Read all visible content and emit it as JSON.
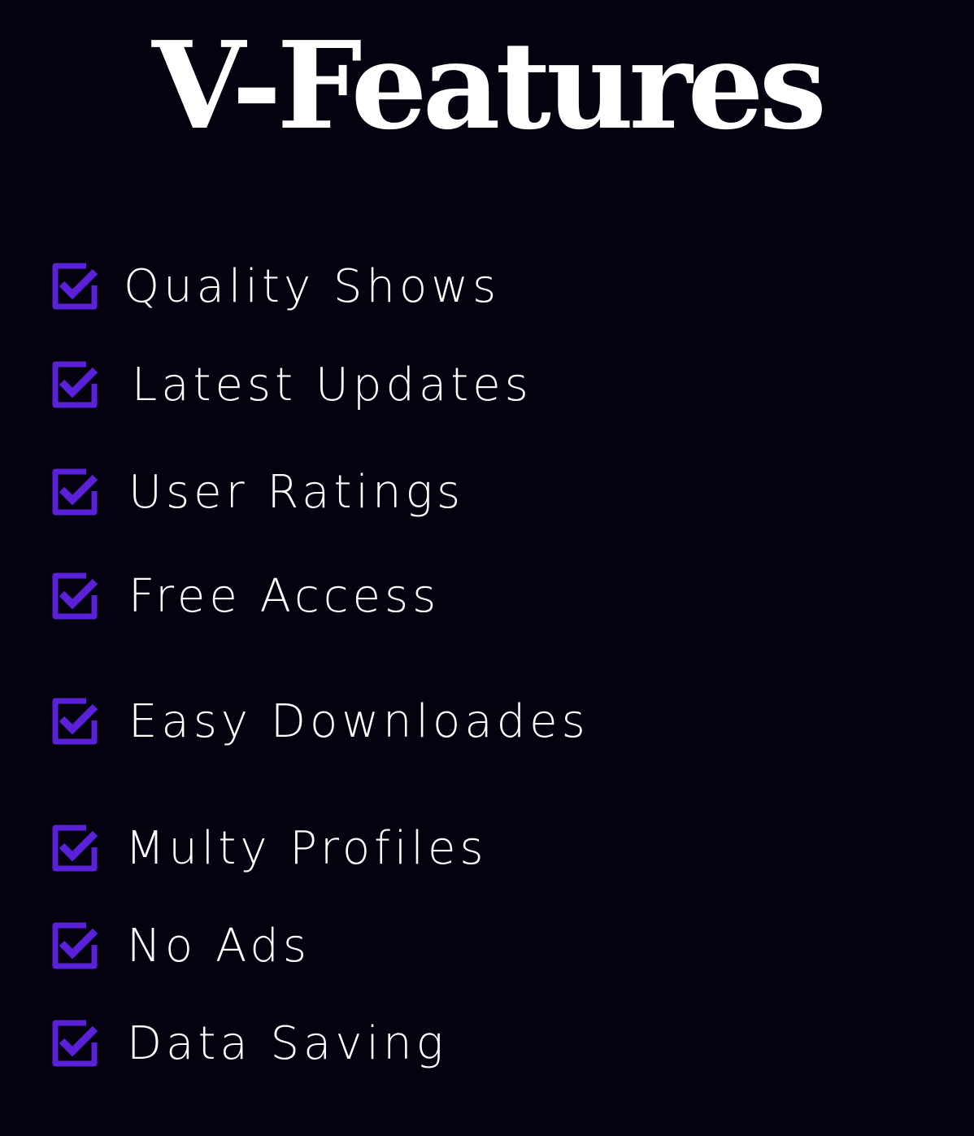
{
  "title": "V-Features",
  "accent_color": "#5b21d8",
  "features": [
    {
      "label": "Quality Shows",
      "icon": "checkbox-checked-icon"
    },
    {
      "label": "Latest Updates",
      "icon": "checkbox-checked-icon"
    },
    {
      "label": "User Ratings",
      "icon": "checkbox-checked-icon"
    },
    {
      "label": "Free Access",
      "icon": "checkbox-checked-icon"
    },
    {
      "label": "Easy Downloades",
      "icon": "checkbox-checked-icon"
    },
    {
      "label": "Multy Profiles",
      "icon": "checkbox-checked-icon"
    },
    {
      "label": "No Ads",
      "icon": "checkbox-checked-icon"
    },
    {
      "label": "Data Saving",
      "icon": "checkbox-checked-icon"
    }
  ]
}
